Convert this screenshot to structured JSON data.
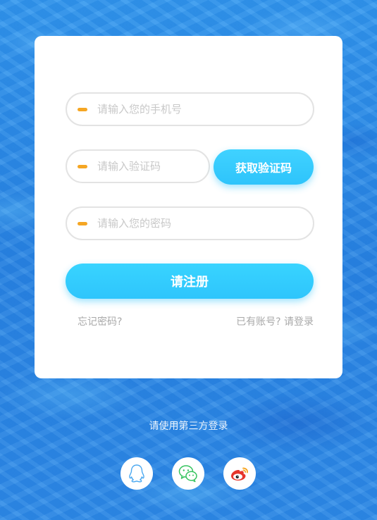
{
  "form": {
    "phone_placeholder": "请输入您的手机号",
    "code_placeholder": "请输入验证码",
    "get_code_label": "获取验证码",
    "password_placeholder": "请输入您的密码",
    "register_label": "请注册",
    "forgot_label": "忘记密码?",
    "have_account_label": "已有账号?",
    "login_label": "请登录"
  },
  "third_party": {
    "title": "请使用第三方登录",
    "providers": [
      {
        "name": "qq-icon"
      },
      {
        "name": "wechat-icon"
      },
      {
        "name": "weibo-icon"
      }
    ]
  },
  "colors": {
    "accent": "#2ec4fb",
    "input_marker": "#f5a623",
    "background": "#2f8fe8"
  }
}
